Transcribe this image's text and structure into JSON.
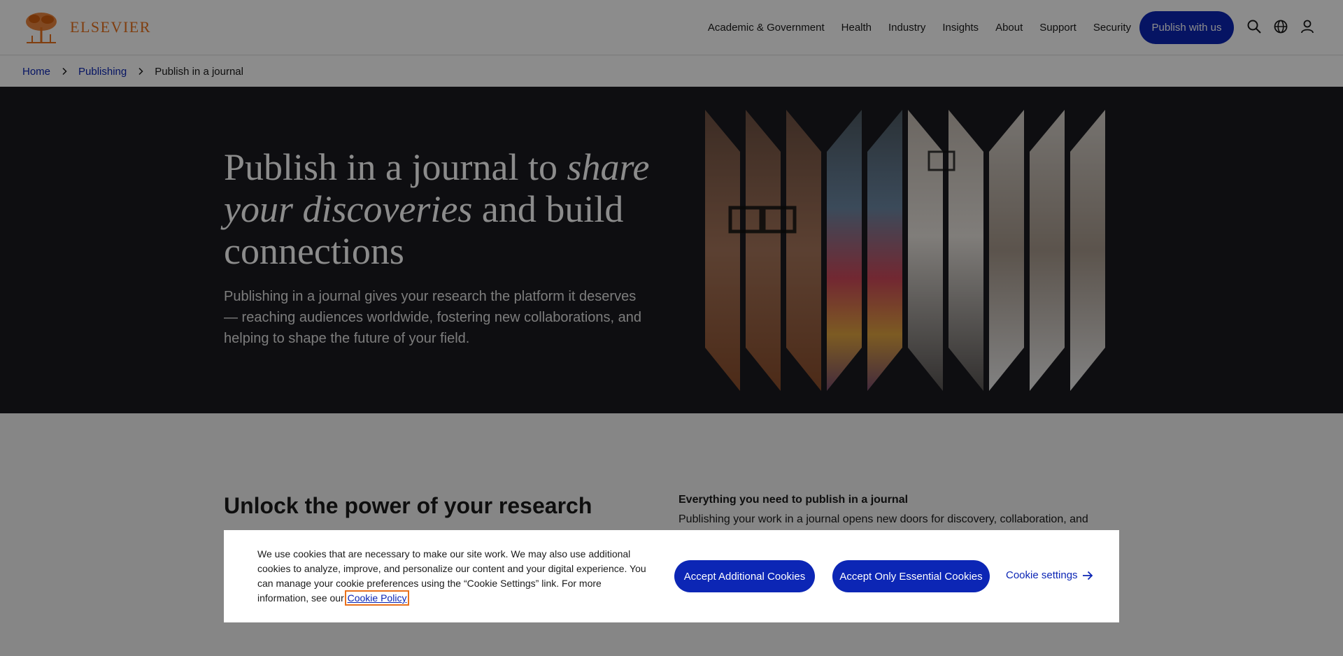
{
  "header": {
    "logo_text": "ELSEVIER",
    "nav": [
      {
        "label": "Academic & Government"
      },
      {
        "label": "Health"
      },
      {
        "label": "Industry"
      },
      {
        "label": "Insights"
      },
      {
        "label": "About"
      },
      {
        "label": "Support"
      },
      {
        "label": "Security"
      }
    ],
    "publish_button": "Publish with us",
    "icons": [
      "search-icon",
      "globe-icon",
      "user-icon"
    ]
  },
  "breadcrumb": {
    "home": "Home",
    "publishing": "Publishing",
    "current": "Publish in a journal"
  },
  "hero": {
    "title_part1": "Publish in a journal to ",
    "title_italic": "share your discoveries",
    "title_part2": " and build connections",
    "description": "Publishing in a journal gives your research the platform it deserves — reaching audiences worldwide, fostering new collaborations, and helping to shape the future of your field."
  },
  "content": {
    "heading": "Unlock the power of your research",
    "subheading": "Everything you need to publish in a journal",
    "body": "Publishing your work in a journal opens new doors for discovery, collaboration, and impact."
  },
  "cookie_banner": {
    "text": "We use cookies that are necessary to make our site work. We may also use additional cookies to analyze, improve, and personalize our content and your digital experience. You can manage your cookie preferences using the “Cookie Settings” link. For more information, see our",
    "link": "Cookie Policy",
    "accept_additional": "Accept Additional Cookies",
    "accept_essential": "Accept Only Essential Cookies",
    "settings": "Cookie settings"
  },
  "colors": {
    "brand_orange": "#e9711c",
    "primary_blue": "#0c26b5",
    "hero_bg": "#1a1a1f"
  }
}
